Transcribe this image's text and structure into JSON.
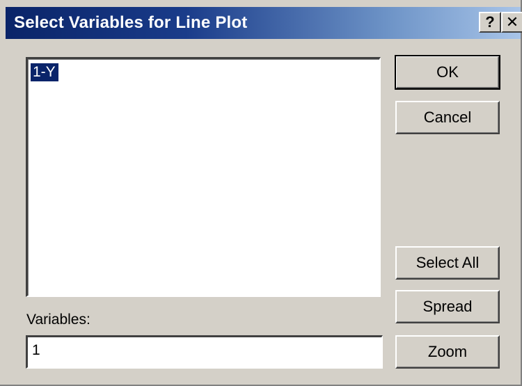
{
  "window": {
    "title": "Select Variables for Line Plot",
    "help_glyph": "?",
    "close_glyph": "✕"
  },
  "listbox": {
    "items": [
      {
        "label": "1-Y",
        "selected": true
      }
    ]
  },
  "buttons": {
    "ok": "OK",
    "cancel": "Cancel",
    "select_all": "Select All",
    "spread": "Spread",
    "zoom": "Zoom"
  },
  "variables": {
    "label": "Variables:",
    "value": "1"
  },
  "colors": {
    "selection": "#0a246a",
    "face": "#d4d0c8"
  }
}
